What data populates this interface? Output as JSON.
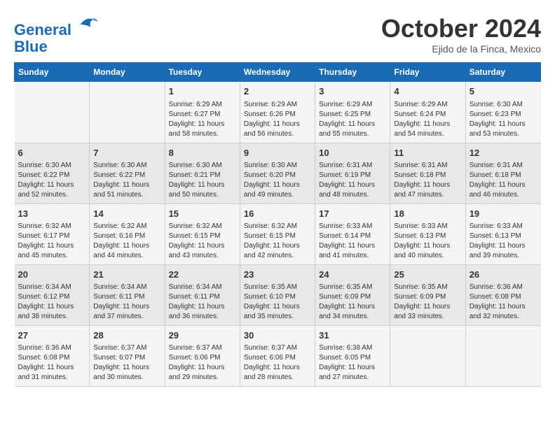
{
  "header": {
    "logo_line1": "General",
    "logo_line2": "Blue",
    "month": "October 2024",
    "location": "Ejido de la Finca, Mexico"
  },
  "weekdays": [
    "Sunday",
    "Monday",
    "Tuesday",
    "Wednesday",
    "Thursday",
    "Friday",
    "Saturday"
  ],
  "weeks": [
    [
      {
        "day": "",
        "info": ""
      },
      {
        "day": "",
        "info": ""
      },
      {
        "day": "1",
        "info": "Sunrise: 6:29 AM\nSunset: 6:27 PM\nDaylight: 11 hours and 58 minutes."
      },
      {
        "day": "2",
        "info": "Sunrise: 6:29 AM\nSunset: 6:26 PM\nDaylight: 11 hours and 56 minutes."
      },
      {
        "day": "3",
        "info": "Sunrise: 6:29 AM\nSunset: 6:25 PM\nDaylight: 11 hours and 55 minutes."
      },
      {
        "day": "4",
        "info": "Sunrise: 6:29 AM\nSunset: 6:24 PM\nDaylight: 11 hours and 54 minutes."
      },
      {
        "day": "5",
        "info": "Sunrise: 6:30 AM\nSunset: 6:23 PM\nDaylight: 11 hours and 53 minutes."
      }
    ],
    [
      {
        "day": "6",
        "info": "Sunrise: 6:30 AM\nSunset: 6:22 PM\nDaylight: 11 hours and 52 minutes."
      },
      {
        "day": "7",
        "info": "Sunrise: 6:30 AM\nSunset: 6:22 PM\nDaylight: 11 hours and 51 minutes."
      },
      {
        "day": "8",
        "info": "Sunrise: 6:30 AM\nSunset: 6:21 PM\nDaylight: 11 hours and 50 minutes."
      },
      {
        "day": "9",
        "info": "Sunrise: 6:30 AM\nSunset: 6:20 PM\nDaylight: 11 hours and 49 minutes."
      },
      {
        "day": "10",
        "info": "Sunrise: 6:31 AM\nSunset: 6:19 PM\nDaylight: 11 hours and 48 minutes."
      },
      {
        "day": "11",
        "info": "Sunrise: 6:31 AM\nSunset: 6:18 PM\nDaylight: 11 hours and 47 minutes."
      },
      {
        "day": "12",
        "info": "Sunrise: 6:31 AM\nSunset: 6:18 PM\nDaylight: 11 hours and 46 minutes."
      }
    ],
    [
      {
        "day": "13",
        "info": "Sunrise: 6:32 AM\nSunset: 6:17 PM\nDaylight: 11 hours and 45 minutes."
      },
      {
        "day": "14",
        "info": "Sunrise: 6:32 AM\nSunset: 6:16 PM\nDaylight: 11 hours and 44 minutes."
      },
      {
        "day": "15",
        "info": "Sunrise: 6:32 AM\nSunset: 6:15 PM\nDaylight: 11 hours and 43 minutes."
      },
      {
        "day": "16",
        "info": "Sunrise: 6:32 AM\nSunset: 6:15 PM\nDaylight: 11 hours and 42 minutes."
      },
      {
        "day": "17",
        "info": "Sunrise: 6:33 AM\nSunset: 6:14 PM\nDaylight: 11 hours and 41 minutes."
      },
      {
        "day": "18",
        "info": "Sunrise: 6:33 AM\nSunset: 6:13 PM\nDaylight: 11 hours and 40 minutes."
      },
      {
        "day": "19",
        "info": "Sunrise: 6:33 AM\nSunset: 6:13 PM\nDaylight: 11 hours and 39 minutes."
      }
    ],
    [
      {
        "day": "20",
        "info": "Sunrise: 6:34 AM\nSunset: 6:12 PM\nDaylight: 11 hours and 38 minutes."
      },
      {
        "day": "21",
        "info": "Sunrise: 6:34 AM\nSunset: 6:11 PM\nDaylight: 11 hours and 37 minutes."
      },
      {
        "day": "22",
        "info": "Sunrise: 6:34 AM\nSunset: 6:11 PM\nDaylight: 11 hours and 36 minutes."
      },
      {
        "day": "23",
        "info": "Sunrise: 6:35 AM\nSunset: 6:10 PM\nDaylight: 11 hours and 35 minutes."
      },
      {
        "day": "24",
        "info": "Sunrise: 6:35 AM\nSunset: 6:09 PM\nDaylight: 11 hours and 34 minutes."
      },
      {
        "day": "25",
        "info": "Sunrise: 6:35 AM\nSunset: 6:09 PM\nDaylight: 11 hours and 33 minutes."
      },
      {
        "day": "26",
        "info": "Sunrise: 6:36 AM\nSunset: 6:08 PM\nDaylight: 11 hours and 32 minutes."
      }
    ],
    [
      {
        "day": "27",
        "info": "Sunrise: 6:36 AM\nSunset: 6:08 PM\nDaylight: 11 hours and 31 minutes."
      },
      {
        "day": "28",
        "info": "Sunrise: 6:37 AM\nSunset: 6:07 PM\nDaylight: 11 hours and 30 minutes."
      },
      {
        "day": "29",
        "info": "Sunrise: 6:37 AM\nSunset: 6:06 PM\nDaylight: 11 hours and 29 minutes."
      },
      {
        "day": "30",
        "info": "Sunrise: 6:37 AM\nSunset: 6:06 PM\nDaylight: 11 hours and 28 minutes."
      },
      {
        "day": "31",
        "info": "Sunrise: 6:38 AM\nSunset: 6:05 PM\nDaylight: 11 hours and 27 minutes."
      },
      {
        "day": "",
        "info": ""
      },
      {
        "day": "",
        "info": ""
      }
    ]
  ]
}
